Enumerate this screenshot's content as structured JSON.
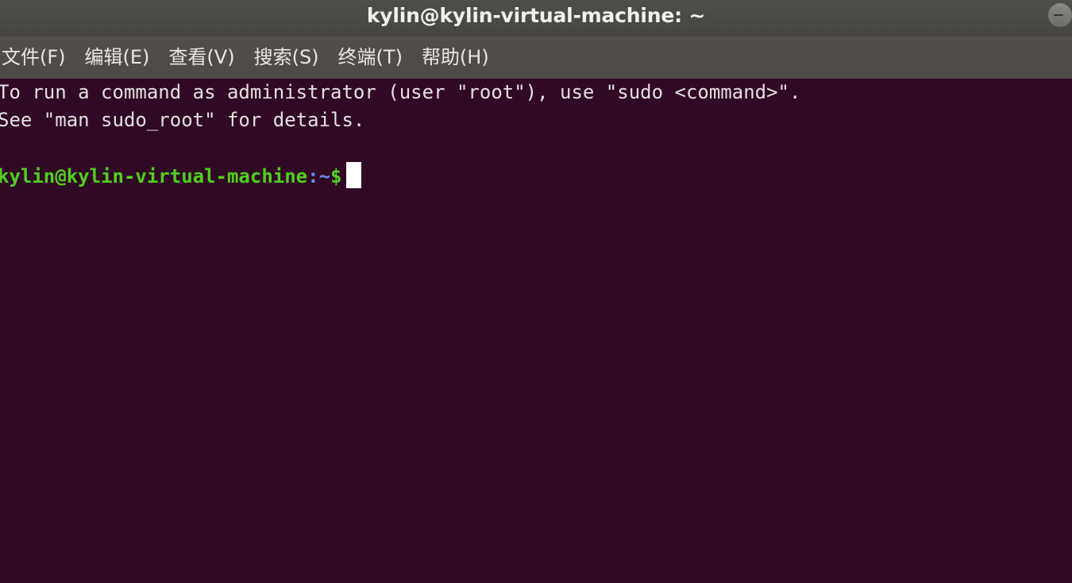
{
  "window": {
    "title": "kylin@kylin-virtual-machine: ~",
    "titlebar_color": "#4b4945",
    "minimize_button_name": "minimize"
  },
  "menubar": {
    "items": [
      {
        "label": "文件(F)"
      },
      {
        "label": "编辑(E)"
      },
      {
        "label": "查看(V)"
      },
      {
        "label": "搜索(S)"
      },
      {
        "label": "终端(T)"
      },
      {
        "label": "帮助(H)"
      }
    ]
  },
  "terminal": {
    "background_color": "#300a24",
    "foreground_color": "#e3e1e0",
    "prompt_color": "#4fd11a",
    "path_color": "#6a8ceb",
    "cursor_color": "#ffffff",
    "lines": [
      {
        "text": "To run a command as administrator (user \"root\"), use \"sudo <command>\"."
      },
      {
        "text": "See \"man sudo_root\" for details."
      },
      {
        "text": ""
      }
    ],
    "prompt": {
      "user_host": "kylin@kylin-virtual-machine",
      "separator": ":",
      "path": "~",
      "symbol": "$",
      "input": ""
    }
  }
}
